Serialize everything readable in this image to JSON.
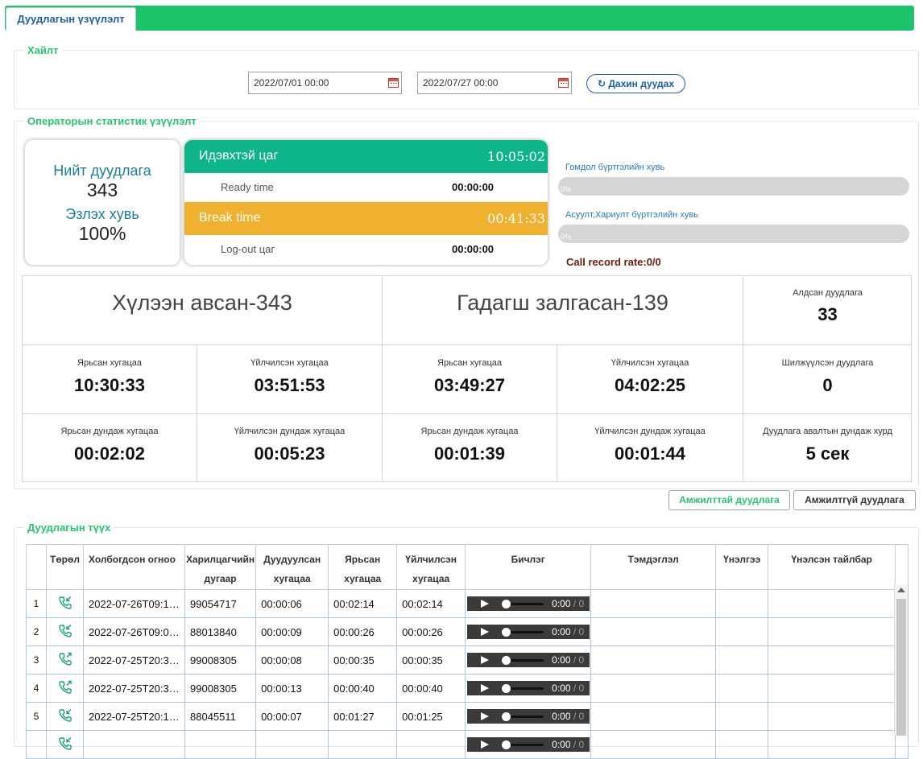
{
  "tab": {
    "label": "Дуудлагын үзүүлэлт"
  },
  "search": {
    "legend": "Хайлт",
    "date_from": "2022/07/01 00:00",
    "date_to": "2022/07/27 00:00",
    "refresh_icon": "↻",
    "refresh_label": "Дахин дуудах"
  },
  "stats": {
    "legend": "Операторын статистик үзүүлэлт",
    "total_calls_label": "Нийт дуудлага",
    "total_calls_value": "343",
    "call_rate_label": "Эзлэх хувь",
    "call_rate_value": "100%",
    "active_time_label": "Идэвхтэй цаг",
    "active_time_value": "10:05:02",
    "ready_time_label": "Ready time",
    "ready_time_value": "00:00:00",
    "break_time_label": "Break time",
    "break_time_value": "00:41:33",
    "logout_label": "Log-out цаг",
    "logout_value": "00:00:00",
    "complaint_label": "Гомдол бүртгэлийн хувь",
    "complaint_pct": "0%",
    "complaint_value": 0,
    "qa_label": "Асуулт,Хариулт бүртгэлийн хувь",
    "qa_pct": "0%",
    "qa_value": 0,
    "call_record_rate": "Call record rate:0/0",
    "colors": {
      "active": "#0fb58a",
      "break": "#f0b030"
    }
  },
  "grid": {
    "received": "Хүлээн авсан-343",
    "outgoing": "Гадагш залгасан-139",
    "missed_label": "Алдсан дуудлага",
    "missed_value": "33",
    "talk_time_label": "Ярьсан хугацаа",
    "service_time_label": "Үйлчилсэн хугацаа",
    "transferred_label": "Шилжүүлсэн дуудлага",
    "avg_talk_label": "Ярьсан дундаж хугацаа",
    "avg_service_label": "Үйлчилсэн дундаж хугацаа",
    "avg_pickup_label": "Дуудлага авалтын дундаж хурд",
    "in_talk": "10:30:33",
    "in_service": "03:51:53",
    "out_talk": "03:49:27",
    "out_service": "04:02:25",
    "transferred_value": "0",
    "in_avg_talk": "00:02:02",
    "in_avg_service": "00:05:23",
    "out_avg_talk": "00:01:39",
    "out_avg_service": "00:01:44",
    "avg_pickup_value": "5 сек"
  },
  "buttons": {
    "success": "Амжилттай дуудлага",
    "failed": "Амжилтгүй дуудлага"
  },
  "history": {
    "legend": "Дуудлагын түүх",
    "columns": {
      "type": "Төрөл",
      "date": "Холбогдсон огноо",
      "phone_1": "Харилцагчийн",
      "phone_2": "дугаар",
      "dialed_1": "Дуудуулсан",
      "dialed_2": "хугацаа",
      "talk_1": "Ярьсан",
      "talk_2": "хугацаа",
      "service_1": "Үйлчилсэн",
      "service_2": "хугацаа",
      "record": "Бичлэг",
      "note": "Тэмдэглэл",
      "rating": "Үнэлгээ",
      "rating_note": "Үнэлсэн тайлбар"
    },
    "player": {
      "time": "0:00",
      "sep": " / 0"
    },
    "rows": [
      {
        "n": "1",
        "icon": "incoming-call-icon",
        "date": "2022-07-26T09:1…",
        "phone": "99054717",
        "dialed": "00:00:06",
        "talk": "00:02:14",
        "service": "00:02:14"
      },
      {
        "n": "2",
        "icon": "incoming-call-icon",
        "date": "2022-07-26T09:0…",
        "phone": "88013840",
        "dialed": "00:00:09",
        "talk": "00:00:26",
        "service": "00:00:26"
      },
      {
        "n": "3",
        "icon": "outgoing-call-icon",
        "date": "2022-07-25T20:3…",
        "phone": "99008305",
        "dialed": "00:00:08",
        "talk": "00:00:35",
        "service": "00:00:35"
      },
      {
        "n": "4",
        "icon": "outgoing-call-icon",
        "date": "2022-07-25T20:3…",
        "phone": "99008305",
        "dialed": "00:00:13",
        "talk": "00:00:40",
        "service": "00:00:40"
      },
      {
        "n": "5",
        "icon": "incoming-call-icon",
        "date": "2022-07-25T20:1…",
        "phone": "88045511",
        "dialed": "00:00:07",
        "talk": "00:01:27",
        "service": "00:01:25"
      },
      {
        "n": "",
        "icon": "incoming-call-icon",
        "date": "",
        "phone": "",
        "dialed": "",
        "talk": "",
        "service": ""
      }
    ]
  }
}
